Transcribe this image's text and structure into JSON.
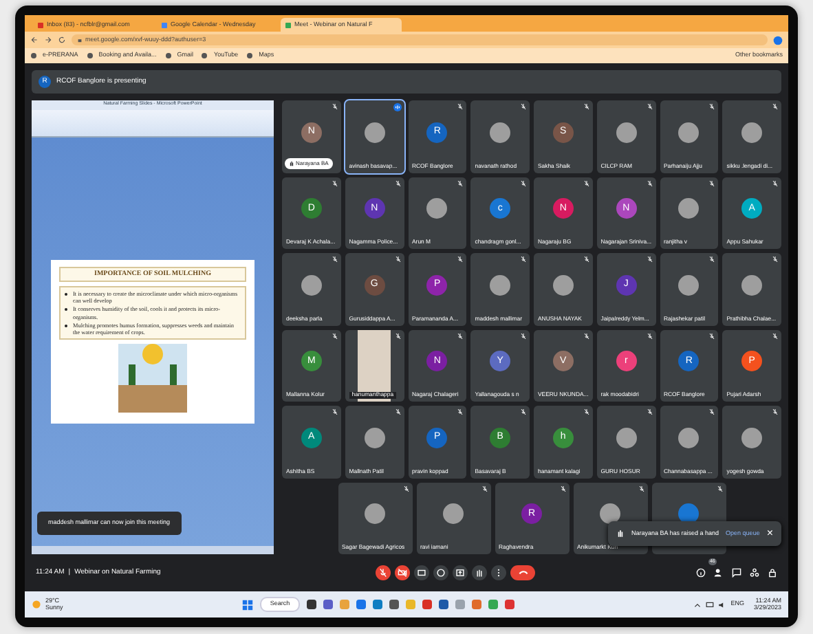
{
  "browser": {
    "tabs": [
      {
        "title": "Inbox (83) - ncfblr@gmail.com",
        "selected": false
      },
      {
        "title": "Google Calendar - Wednesday",
        "selected": false
      },
      {
        "title": "Meet - Webinar on Natural F",
        "selected": true
      }
    ],
    "address": "meet.google.com/xvf-wuuy-ddd?authuser=3",
    "bookmarks": [
      "e-PRERANA",
      "Booking and Availa...",
      "Gmail",
      "YouTube",
      "Maps"
    ],
    "other_bookmarks": "Other bookmarks"
  },
  "meet": {
    "banner": {
      "letter": "R",
      "text": "RCOF Banglore is presenting"
    },
    "slide_window": {
      "title": "Natural Farming Slides - Microsoft PowerPoint",
      "heading": "IMPORTANCE OF SOIL MULCHING",
      "bullets": [
        "It is necessary to create the microclimate under which micro-organisms can well develop",
        "It conserves humidity of the soil, cools it and  protects its micro-organisms.",
        "Mulching promotes humus formation,  suppresses weeds and maintain the water  requirement of crops."
      ]
    },
    "toast": "maddesh mallimar can now join this meeting",
    "tiles": [
      {
        "name": "Narayana BA",
        "kind": "letter",
        "letter": "N",
        "color": "#8d6e63",
        "speaking": false,
        "hand_raised": true
      },
      {
        "name": "avinash basavap...",
        "kind": "photo",
        "speaking": true,
        "hand_raised": false
      },
      {
        "name": "RCOF Banglore",
        "kind": "letter",
        "letter": "R",
        "color": "#1565c0",
        "speaking": false,
        "hand_raised": false
      },
      {
        "name": "navanath rathod",
        "kind": "photo",
        "speaking": false,
        "hand_raised": false
      },
      {
        "name": "Sakha Shaik",
        "kind": "letter",
        "letter": "S",
        "color": "#795548",
        "speaking": false,
        "hand_raised": false
      },
      {
        "name": "CILCP RAM",
        "kind": "photo",
        "speaking": false,
        "hand_raised": false
      },
      {
        "name": "Parhanaiju Ajju",
        "kind": "photo",
        "speaking": false,
        "hand_raised": false
      },
      {
        "name": "sikku .lengadi di...",
        "kind": "photo",
        "speaking": false,
        "hand_raised": false
      },
      {
        "name": "Devaraj K Achala...",
        "kind": "letter",
        "letter": "D",
        "color": "#2e7d32",
        "speaking": false,
        "hand_raised": false
      },
      {
        "name": "Nagamma Police...",
        "kind": "letter",
        "letter": "N",
        "color": "#5e35b1",
        "speaking": false,
        "hand_raised": false
      },
      {
        "name": "Arun M",
        "kind": "photo",
        "speaking": false,
        "hand_raised": false
      },
      {
        "name": "chandragm gonl...",
        "kind": "letter",
        "letter": "c",
        "color": "#1976d2",
        "speaking": false,
        "hand_raised": false
      },
      {
        "name": "Nagaraju BG",
        "kind": "letter",
        "letter": "N",
        "color": "#d81b60",
        "speaking": false,
        "hand_raised": false
      },
      {
        "name": "Nagarajan Sriniva...",
        "kind": "letter",
        "letter": "N",
        "color": "#ab47bc",
        "speaking": false,
        "hand_raised": false
      },
      {
        "name": "ranjitha v",
        "kind": "photo",
        "speaking": false,
        "hand_raised": false
      },
      {
        "name": "Appu Sahukar",
        "kind": "letter",
        "letter": "A",
        "color": "#00acc1",
        "speaking": false,
        "hand_raised": false
      },
      {
        "name": "deeksha parla",
        "kind": "photo",
        "speaking": false,
        "hand_raised": false
      },
      {
        "name": "Gurusiddappa A...",
        "kind": "letter",
        "letter": "G",
        "color": "#6d4c41",
        "speaking": false,
        "hand_raised": false
      },
      {
        "name": "Paramananda A...",
        "kind": "letter",
        "letter": "P",
        "color": "#8e24aa",
        "speaking": false,
        "hand_raised": false
      },
      {
        "name": "maddesh mallimar",
        "kind": "photo",
        "speaking": false,
        "hand_raised": false
      },
      {
        "name": "ANUSHA NAYAK",
        "kind": "photo",
        "speaking": false,
        "hand_raised": false
      },
      {
        "name": "Jaipalreddy Yelm...",
        "kind": "letter",
        "letter": "J",
        "color": "#5e35b1",
        "speaking": false,
        "hand_raised": false
      },
      {
        "name": "Rajashekar patil",
        "kind": "photo",
        "speaking": false,
        "hand_raised": false
      },
      {
        "name": "Prathibha Chalae...",
        "kind": "photo",
        "speaking": false,
        "hand_raised": false
      },
      {
        "name": "Mallanna Kolur",
        "kind": "letter",
        "letter": "M",
        "color": "#388e3c",
        "speaking": false,
        "hand_raised": false
      },
      {
        "name": "hanumanthappa",
        "kind": "video",
        "speaking": false,
        "hand_raised": false
      },
      {
        "name": "Nagaraj Chalageri",
        "kind": "letter",
        "letter": "N",
        "color": "#7b1fa2",
        "speaking": false,
        "hand_raised": false
      },
      {
        "name": "Yallanagouda s n",
        "kind": "letter",
        "letter": "Y",
        "color": "#5c6bc0",
        "speaking": false,
        "hand_raised": false
      },
      {
        "name": "VEERU NKUNDA...",
        "kind": "letter",
        "letter": "V",
        "color": "#8d6e63",
        "speaking": false,
        "hand_raised": false
      },
      {
        "name": "rak moodabidri",
        "kind": "letter",
        "letter": "r",
        "color": "#ec407a",
        "speaking": false,
        "hand_raised": false
      },
      {
        "name": "RCOF Banglore",
        "kind": "letter",
        "letter": "R",
        "color": "#1565c0",
        "speaking": false,
        "hand_raised": false
      },
      {
        "name": "Pujari Adarsh",
        "kind": "letter",
        "letter": "P",
        "color": "#f4511e",
        "speaking": false,
        "hand_raised": false
      },
      {
        "name": "Ashitha BS",
        "kind": "letter",
        "letter": "A",
        "color": "#00897b",
        "speaking": false,
        "hand_raised": false
      },
      {
        "name": "Mallnath Patil",
        "kind": "photo",
        "speaking": false,
        "hand_raised": false
      },
      {
        "name": "pravin koppad",
        "kind": "letter",
        "letter": "P",
        "color": "#1565c0",
        "speaking": false,
        "hand_raised": false
      },
      {
        "name": "Basavaraj B",
        "kind": "letter",
        "letter": "B",
        "color": "#2e7d32",
        "speaking": false,
        "hand_raised": false
      },
      {
        "name": "hanamant kalagi",
        "kind": "letter",
        "letter": "h",
        "color": "#388e3c",
        "speaking": false,
        "hand_raised": false
      },
      {
        "name": "GURU HOSUR",
        "kind": "photo",
        "speaking": false,
        "hand_raised": false
      },
      {
        "name": "Channabasappa ...",
        "kind": "photo",
        "speaking": false,
        "hand_raised": false
      },
      {
        "name": "yogesh gowda",
        "kind": "photo",
        "speaking": false,
        "hand_raised": false
      },
      {
        "name": "Sagar Bagewadi Agricos",
        "kind": "photo",
        "speaking": false,
        "hand_raised": false
      },
      {
        "name": "ravi iamani",
        "kind": "photo",
        "speaking": false,
        "hand_raised": false
      },
      {
        "name": "Raghavendra",
        "kind": "letter",
        "letter": "R",
        "color": "#7b1fa2",
        "speaking": false,
        "hand_raised": false
      },
      {
        "name": "Anikumarkt Kun",
        "kind": "photo",
        "speaking": false,
        "hand_raised": false
      },
      {
        "kind": "letter",
        "color": "#1976d2",
        "speaking": false
      }
    ],
    "hand_raise": {
      "message": "Narayana BA has raised a hand",
      "action": "Open queue",
      "close": "×"
    },
    "time": "11:24 AM",
    "separator": "|",
    "meeting_title": "Webinar on Natural Farming",
    "people_count": "46"
  },
  "taskbar": {
    "temp": "29°C",
    "weather": "Sunny",
    "search": "Search",
    "lang": "ENG",
    "time": "11:24 AM",
    "date": "3/29/2023"
  }
}
